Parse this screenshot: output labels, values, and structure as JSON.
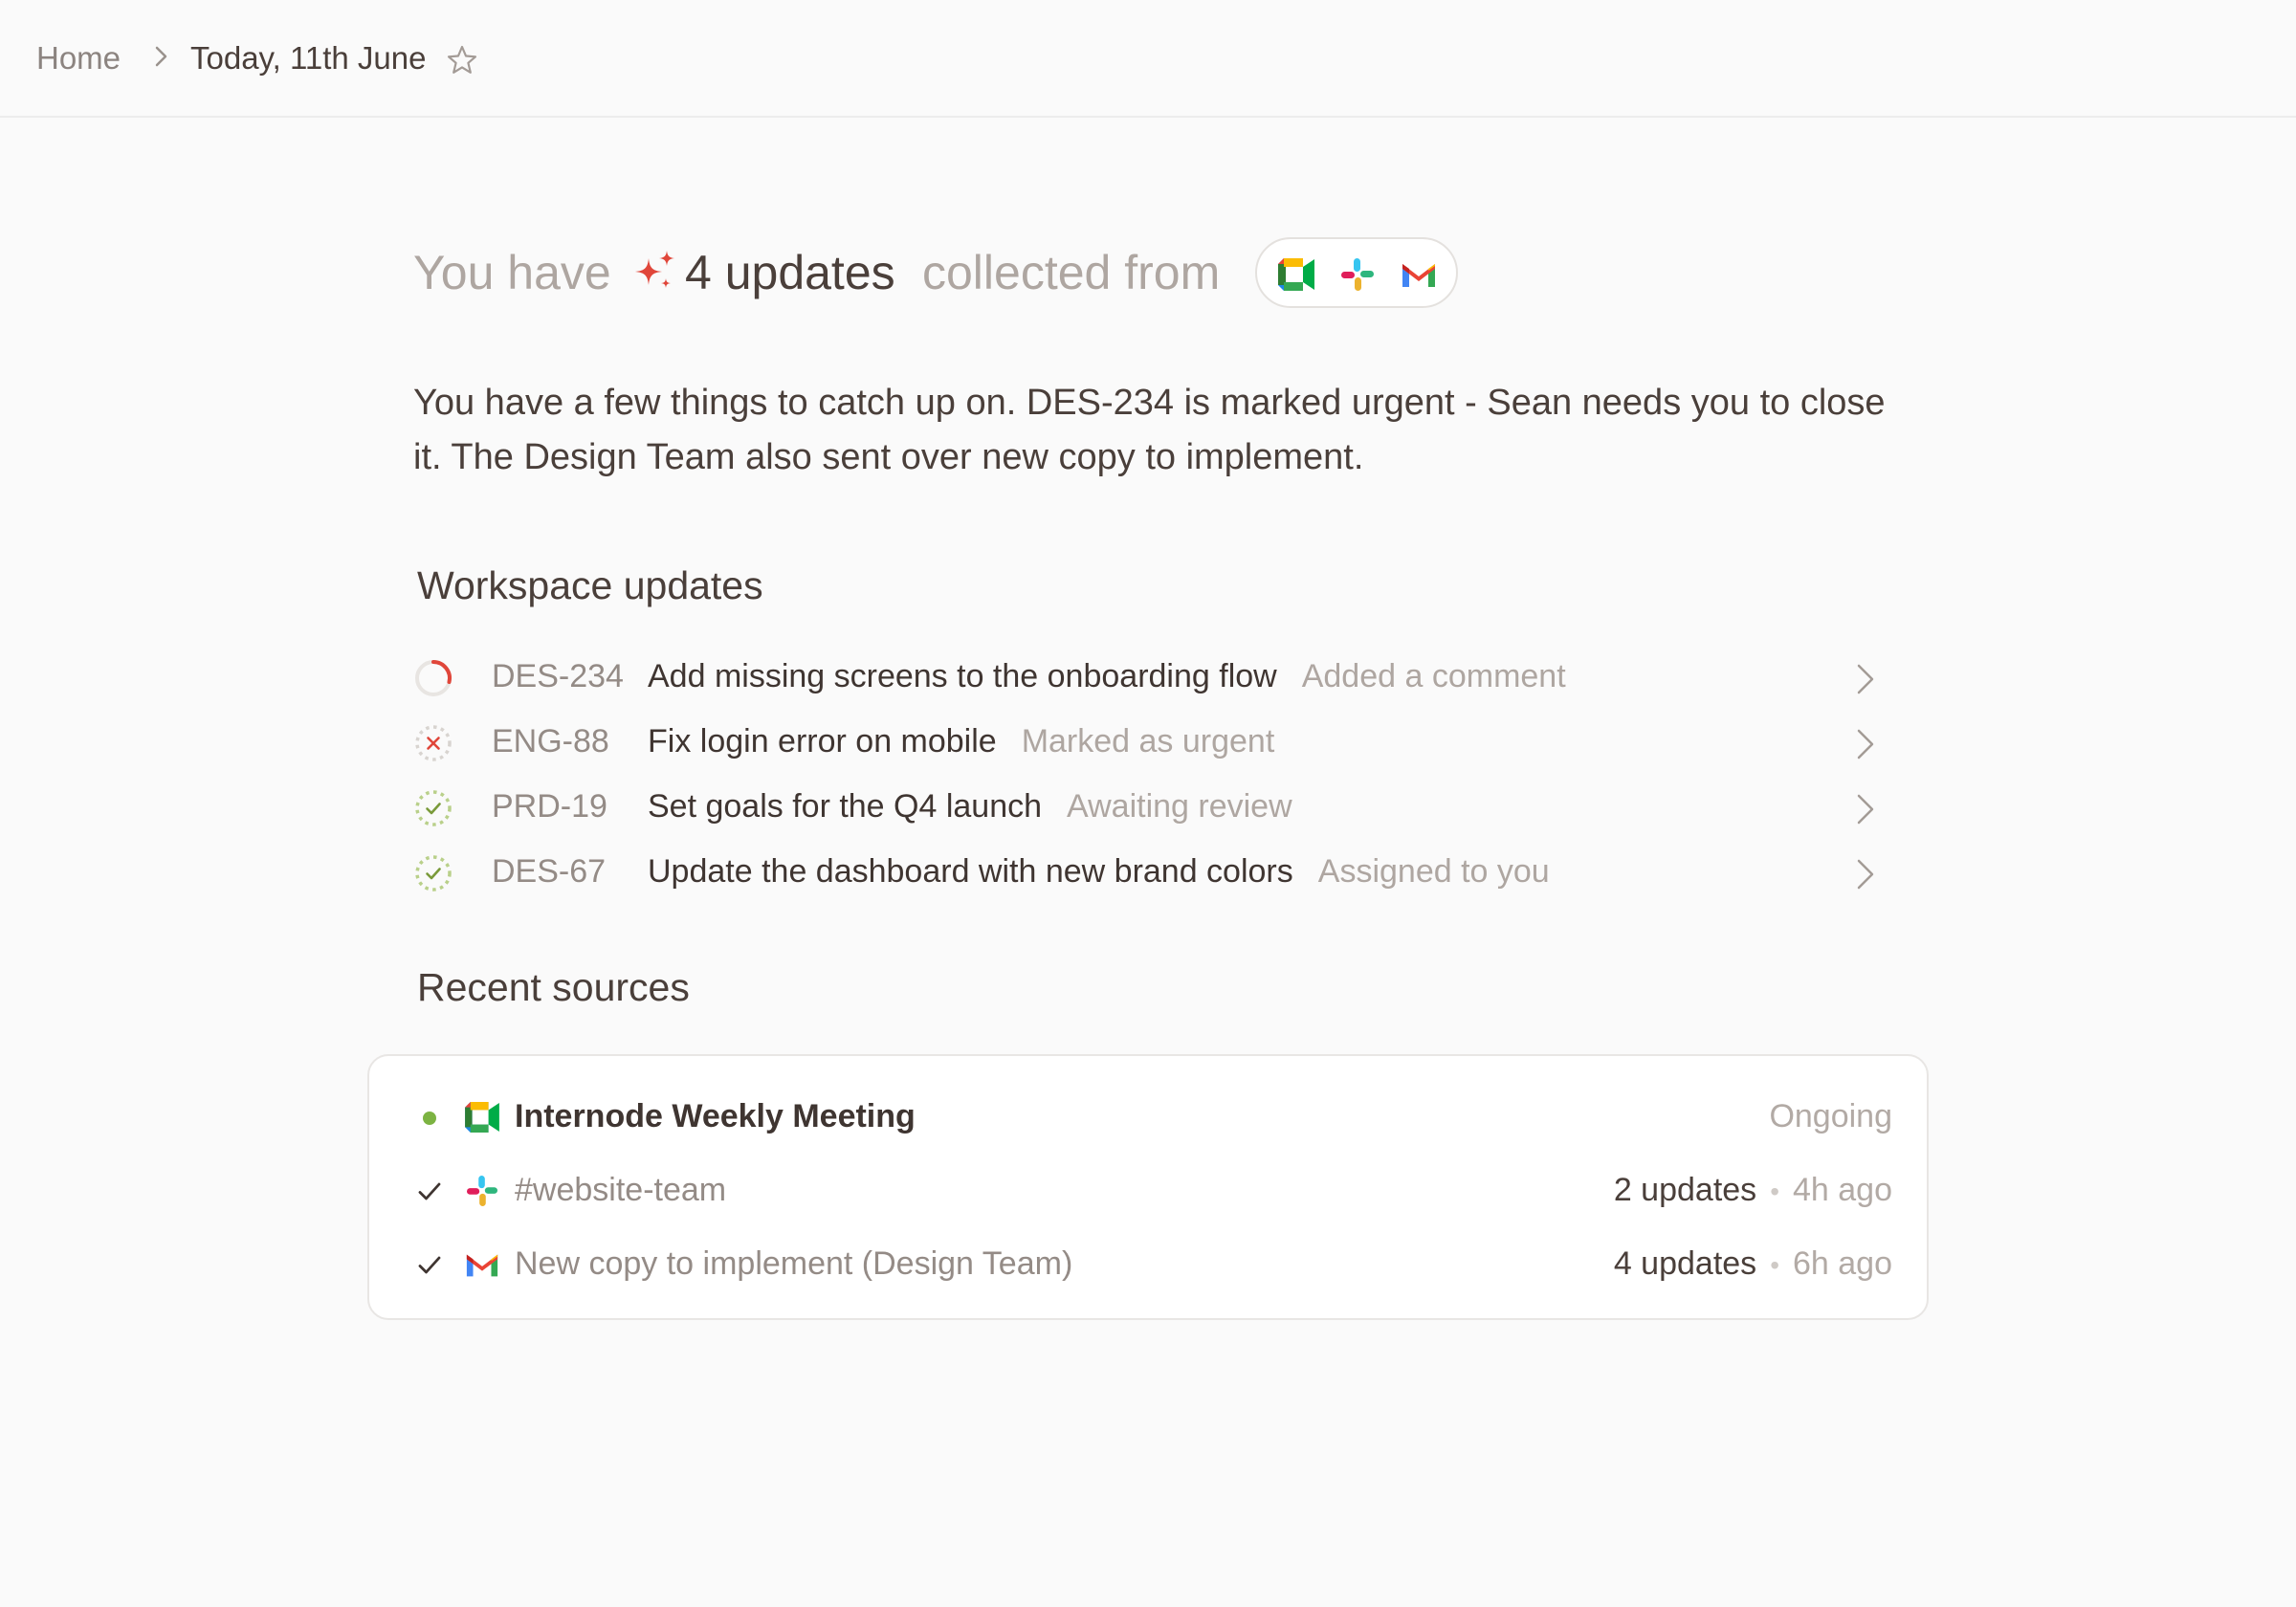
{
  "breadcrumb": {
    "home": "Home",
    "current": "Today, 11th June"
  },
  "headline": {
    "prefix": "You have",
    "count": "4 updates",
    "suffix": "collected from",
    "apps": [
      "google-meet-icon",
      "slack-icon",
      "gmail-icon"
    ]
  },
  "summary": "You have a few things to catch up on. DES-234 is marked urgent - Sean needs you to close it. The Design Team also sent over new copy to implement.",
  "workspace": {
    "title": "Workspace updates",
    "items": [
      {
        "id": "DES-234",
        "title": "Add missing screens to the onboarding flow",
        "status": "Added a comment",
        "icon": "in-progress-icon"
      },
      {
        "id": "ENG-88",
        "title": "Fix login error on mobile",
        "status": "Marked as urgent",
        "icon": "cancelled-icon"
      },
      {
        "id": "PRD-19",
        "title": "Set goals for the Q4 launch",
        "status": "Awaiting review",
        "icon": "done-dashed-icon"
      },
      {
        "id": "DES-67",
        "title": "Update the dashboard with new brand colors",
        "status": "Assigned to you",
        "icon": "done-dashed-icon"
      }
    ]
  },
  "sources": {
    "title": "Recent sources",
    "items": [
      {
        "name": "Internode Weekly Meeting",
        "status": "Ongoing",
        "app": "google-meet-icon",
        "lead": "live-dot-icon"
      },
      {
        "name": "#website-team",
        "count": "2 updates",
        "ago": "4h ago",
        "app": "slack-icon",
        "lead": "check-icon"
      },
      {
        "name": "New copy to implement (Design Team)",
        "count": "4 updates",
        "ago": "6h ago",
        "app": "gmail-icon",
        "lead": "check-icon"
      }
    ]
  },
  "colors": {
    "accent_red": "#e0463a",
    "live_green": "#7cb342",
    "done_green": "#a9c46c",
    "text_main": "#4a3f3a",
    "text_muted": "#aea6a1"
  }
}
